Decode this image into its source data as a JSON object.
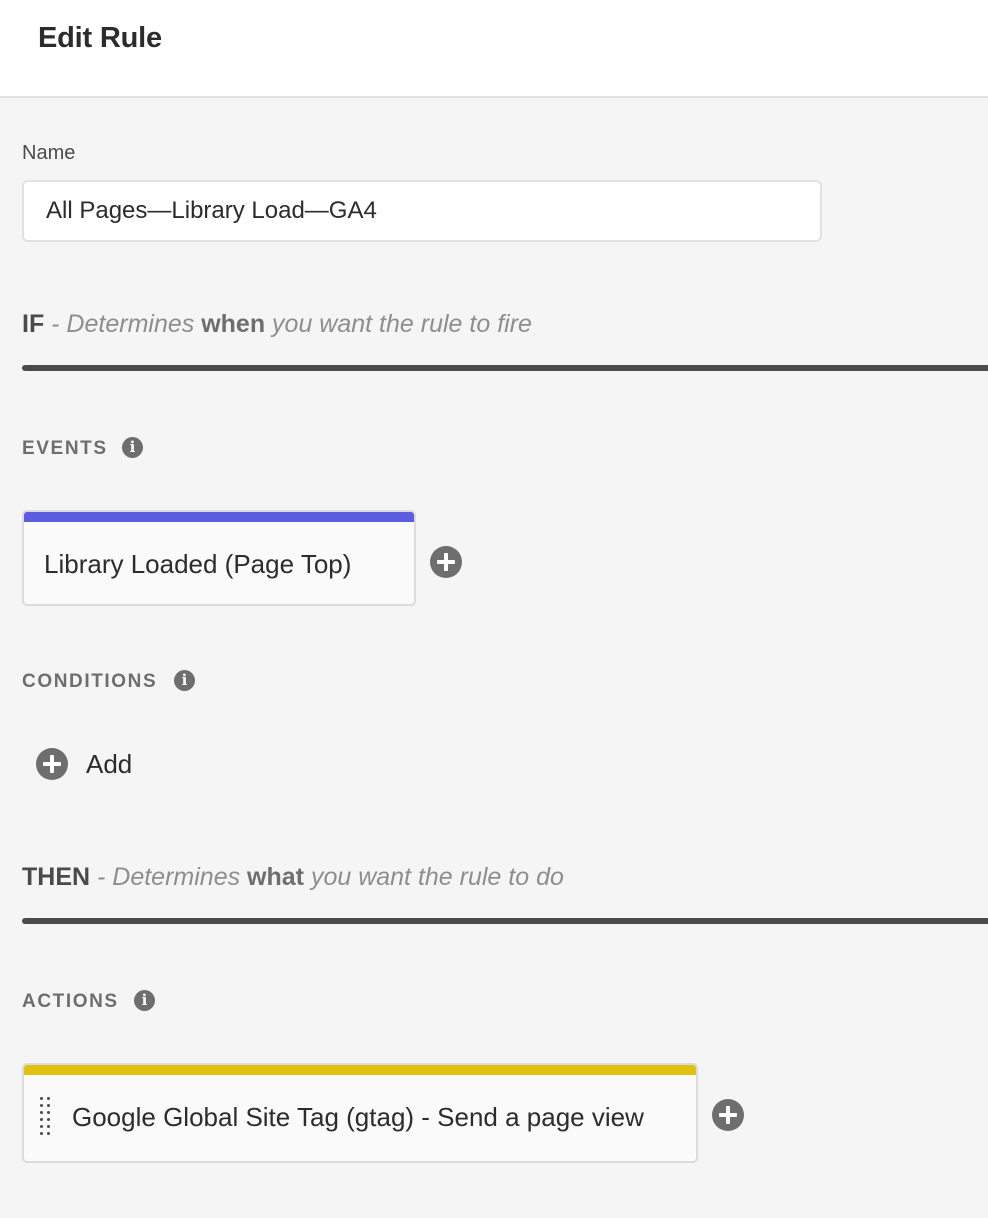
{
  "header": {
    "title": "Edit Rule"
  },
  "name_field": {
    "label": "Name",
    "value": "All Pages—Library Load—GA4"
  },
  "if_section": {
    "keyword": "IF",
    "desc_prefix": " - Determines ",
    "desc_emphasis": "when",
    "desc_suffix": " you want the rule to fire"
  },
  "events": {
    "label": "EVENTS",
    "info_icon": "info-icon",
    "items": [
      {
        "label": "Library Loaded (Page Top)",
        "stripe_color": "#5c5ce0"
      }
    ],
    "add_icon": "plus-circle-icon"
  },
  "conditions": {
    "label": "CONDITIONS",
    "info_icon": "info-icon",
    "add_label": "Add",
    "add_icon": "plus-circle-icon"
  },
  "then_section": {
    "keyword": "THEN",
    "desc_prefix": " - Determines ",
    "desc_emphasis": "what",
    "desc_suffix": " you want the rule to do"
  },
  "actions": {
    "label": "ACTIONS",
    "info_icon": "info-icon",
    "items": [
      {
        "label": "Google Global Site Tag (gtag) - Send a page view",
        "stripe_color": "#e0c010",
        "handle_icon": "drag-handle-icon"
      }
    ],
    "add_icon": "plus-circle-icon"
  }
}
